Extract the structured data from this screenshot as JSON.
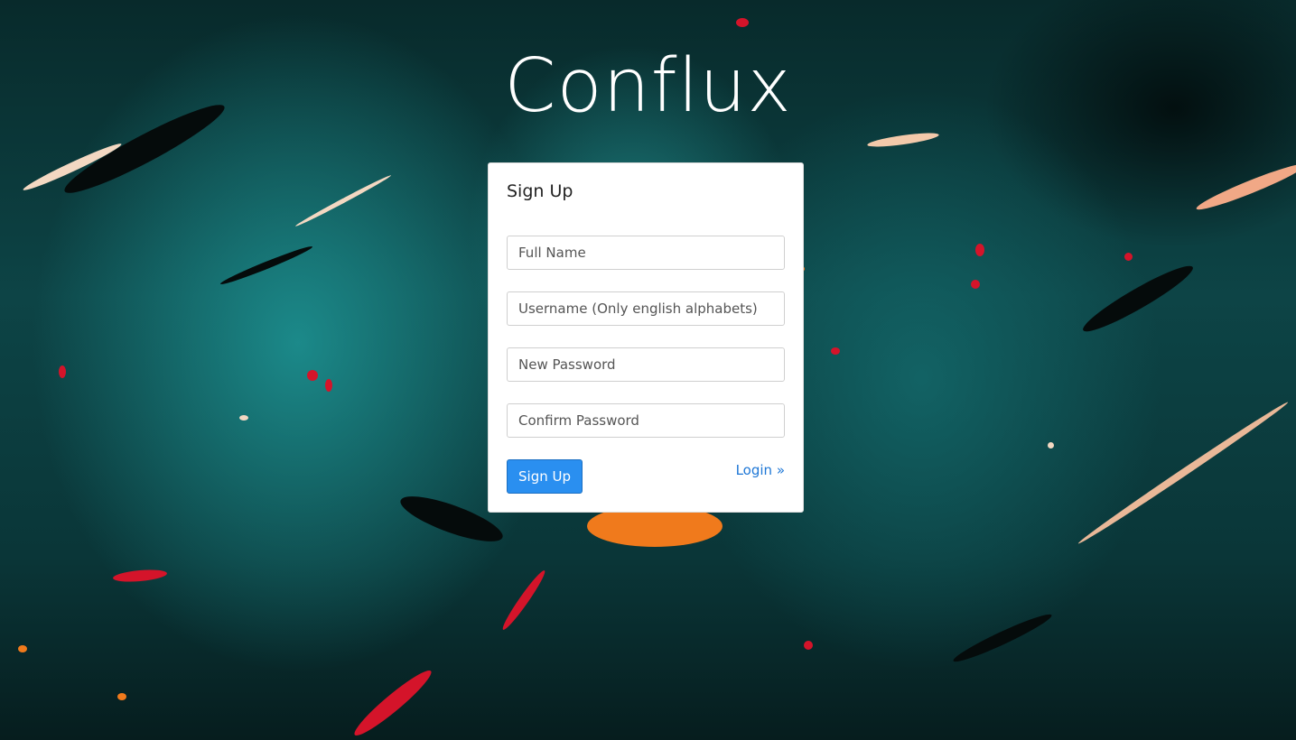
{
  "app": {
    "brand": "Conflux"
  },
  "form": {
    "title": "Sign Up",
    "fields": {
      "full_name": {
        "placeholder": "Full Name",
        "value": ""
      },
      "username": {
        "placeholder": "Username (Only english alphabets)",
        "value": ""
      },
      "new_password": {
        "placeholder": "New Password",
        "value": ""
      },
      "confirm_password": {
        "placeholder": "Confirm Password",
        "value": ""
      }
    },
    "submit_label": "Sign Up",
    "login_link": "Login »"
  },
  "colors": {
    "accent": "#2a8ff0",
    "link": "#1e77d6",
    "background": "#0d4446"
  }
}
